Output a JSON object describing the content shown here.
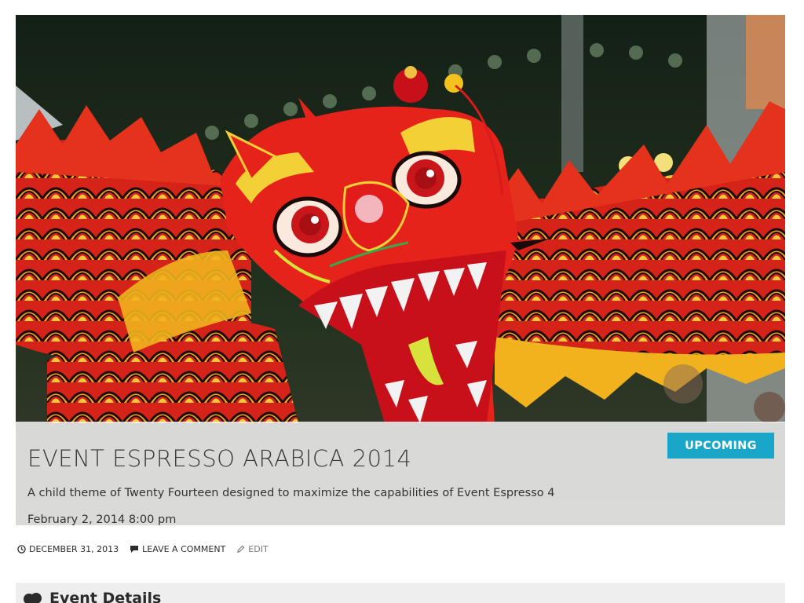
{
  "event": {
    "title": "EVENT ESPRESSO ARABICA 2014",
    "tagline": "A child theme of Twenty Fourteen designed to maximize the capabilities of Event Espresso 4",
    "datetime": "February 2, 2014 8:00 pm",
    "status": "UPCOMING",
    "status_color": "#1aa6c8"
  },
  "hero_image": {
    "subject": "chinese-dragon-dance-photo"
  },
  "meta": {
    "date": "DECEMBER 31, 2013",
    "comment": "LEAVE A COMMENT",
    "edit": "EDIT",
    "icons": [
      "clock-icon",
      "comment-icon",
      "pencil-icon"
    ]
  },
  "details_section": {
    "title": "Event Details",
    "icon": "details-icon"
  }
}
